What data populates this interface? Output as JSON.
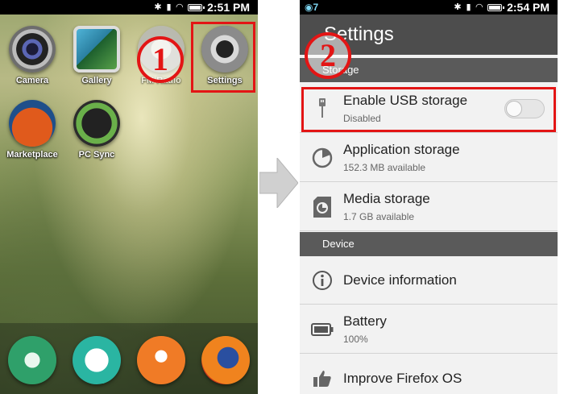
{
  "left_phone": {
    "status": {
      "time": "2:51 PM"
    },
    "apps": [
      {
        "label": "Camera"
      },
      {
        "label": "Gallery"
      },
      {
        "label": "FM Radio"
      },
      {
        "label": "Settings"
      },
      {
        "label": "Marketplace"
      },
      {
        "label": "PC Sync"
      }
    ],
    "step_number": "1"
  },
  "right_phone": {
    "status": {
      "time": "2:54 PM",
      "notification": "7"
    },
    "header_title": "Settings",
    "step_number": "2",
    "storage_section": "Storage",
    "rows": [
      {
        "title": "Enable USB storage",
        "subtitle": "Disabled",
        "toggle_on": false
      },
      {
        "title": "Application storage",
        "subtitle": "152.3 MB available"
      },
      {
        "title": "Media storage",
        "subtitle": "1.7 GB available"
      }
    ],
    "device_section": "Device",
    "device_rows": [
      {
        "title": "Device information"
      },
      {
        "title": "Battery",
        "subtitle": "100%"
      },
      {
        "title": "Improve Firefox OS"
      }
    ]
  },
  "colors": {
    "highlight": "#e31515",
    "header_bg": "#4d4d4d",
    "section_bg": "#5a5a5a",
    "list_bg": "#f2f2f2"
  }
}
